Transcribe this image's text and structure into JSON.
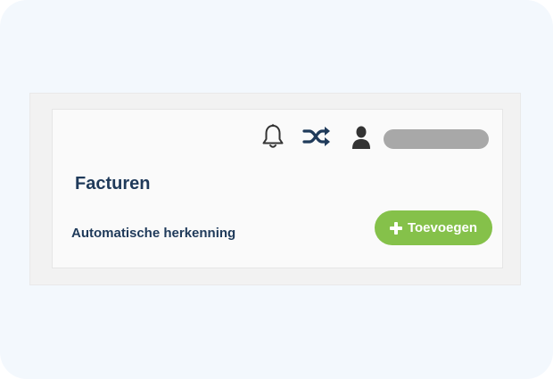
{
  "header": {
    "icons": {
      "notifications": "bell-icon",
      "switch": "shuffle-icon",
      "account": "user-icon"
    },
    "user_name": ""
  },
  "main": {
    "title": "Facturen",
    "subtitle": "Automatische herkenning",
    "add_button_label": "Toevoegen"
  },
  "colors": {
    "background": "#f3f8fd",
    "heading": "#1f3a5a",
    "accent_green": "#85c14a",
    "placeholder_gray": "#a8a8a8"
  }
}
